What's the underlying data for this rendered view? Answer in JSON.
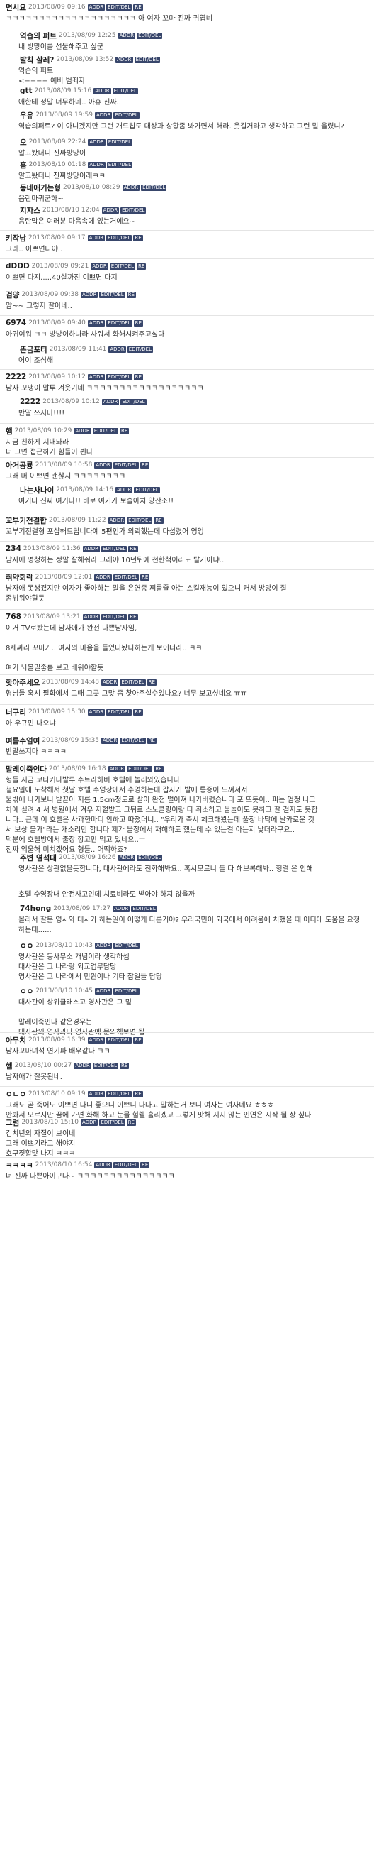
{
  "buttons": {
    "addr": "ADDR",
    "edit": "EDIT/DEL",
    "re": "RE"
  },
  "comments": [
    {
      "level": 0,
      "h": 40,
      "nick": "면시요",
      "date": "2013/08/09 09:16",
      "re": true,
      "body": "ㅋㅋㅋㅋㅋㅋㅋㅋㅋㅋㅋㅋㅋㅋㅋㅋㅋㅋㅋㅋ 아 여자 꼬마 진짜 귀엽네"
    },
    {
      "level": 1,
      "h": 34,
      "nick": "역습의 퍼트",
      "date": "2013/08/09 12:25",
      "re": false,
      "body": "내 방망이를 선물해주고 싶군"
    },
    {
      "level": 1,
      "h": 44,
      "nick": "발칙 샬레?",
      "date": "2013/08/09 13:52",
      "re": false,
      "body": "역습의 퍼트\n<==== 예비 범죄자"
    },
    {
      "level": 1,
      "h": 34,
      "nick": "gtt",
      "date": "2013/08/09 15:16",
      "re": false,
      "body": "애한테 정말 너무하네.. 아휴 진짜.."
    },
    {
      "level": 1,
      "h": 38,
      "nick": "우유",
      "date": "2013/08/09 19:59",
      "re": false,
      "body": "역습의퍼트? 이 아니겠지만 그런 개드립도 대상과 상황좀 봐가면서 해라. 웃길거라고 생각하고 그런 말 올렸니?"
    },
    {
      "level": 1,
      "h": 32,
      "nick": "오",
      "date": "2013/08/09 22:24",
      "re": false,
      "body": "알고봤더니 진짜방망이"
    },
    {
      "level": 1,
      "h": 32,
      "nick": "흠",
      "date": "2013/08/10 01:18",
      "re": false,
      "body": "알고봤더니 진짜방망이래ㅋㅋ"
    },
    {
      "level": 1,
      "h": 32,
      "nick": "동네애기는형",
      "date": "2013/08/10 08:29",
      "re": false,
      "body": "음란마귀군하~"
    },
    {
      "level": 1,
      "h": 38,
      "nick": "지자스",
      "date": "2013/08/10 12:04",
      "re": false,
      "body": "음란맙은 여러분 마음속에 있는거에요~"
    },
    {
      "level": 0,
      "h": 40,
      "nick": "키작남",
      "date": "2013/08/09 09:17",
      "re": true,
      "body": "그래.. 이쁘면다야.."
    },
    {
      "level": 0,
      "h": 40,
      "nick": "dDDD",
      "date": "2013/08/09 09:21",
      "re": true,
      "body": "이쁘면 다지.....40살까진 이쁘면 다지"
    },
    {
      "level": 0,
      "h": 40,
      "nick": "검양",
      "date": "2013/08/09 09:38",
      "re": true,
      "body": "암~~ 그렇지 잘아네.."
    },
    {
      "level": 0,
      "h": 38,
      "nick": "6974",
      "date": "2013/08/09 09:40",
      "re": true,
      "body": "아귀여워 ㅋㅋ 방방이하나라 사줘서 화해시켜주고싶다"
    },
    {
      "level": 1,
      "h": 38,
      "nick": "뜬금포티",
      "date": "2013/08/09 11:41",
      "re": false,
      "body": "어이 조심해"
    },
    {
      "level": 0,
      "h": 36,
      "nick": "2222",
      "date": "2013/08/09 10:12",
      "re": true,
      "body": "남자 꼬맹이 말투 겨웃기네 ㅋㅋㅋㅋㅋㅋㅋㅋㅋㅋㅋㅋㅋㅋㅋㅋㅋㅋ"
    },
    {
      "level": 1,
      "h": 40,
      "nick": "2222",
      "date": "2013/08/09 10:12",
      "re": false,
      "body": "반말 쓰지마!!!!"
    },
    {
      "level": 0,
      "h": 48,
      "nick": "햄",
      "date": "2013/08/09 10:29",
      "re": true,
      "body": "지금 친하게 지내놔라\n더 크면 접근하기 힘들어 뵌다"
    },
    {
      "level": 0,
      "h": 36,
      "nick": "아거공룡",
      "date": "2013/08/09 10:58",
      "re": true,
      "body": "그래 머 이쁘면 괜찮지 ㅋㅋㅋㅋㅋㅋㅋㅋ"
    },
    {
      "level": 1,
      "h": 42,
      "nick": "나는사나이",
      "date": "2013/08/09 14:16",
      "re": false,
      "body": "여기다 진짜 여기다!! 바로 여기가 보슬아치 양산소!!"
    },
    {
      "level": 0,
      "h": 40,
      "nick": "꼬부기전결합",
      "date": "2013/08/09 11:22",
      "re": true,
      "body": "꼬부기전결형 포샵해드립니다예 5편인가 의뢰했는데 다섭렸어 영엉"
    },
    {
      "level": 0,
      "h": 40,
      "nick": "234",
      "date": "2013/08/09 11:36",
      "re": true,
      "body": "남자애 명청하는 정말 잘해줘라 그래야 10년뒤에 천한척이라도 탈거아냐.."
    },
    {
      "level": 0,
      "h": 56,
      "nick": "취약회락",
      "date": "2013/08/09 12:01",
      "re": true,
      "body": "남자애 못생겼지만 여자가 좋아하는 말을 은연중 찌를줄 아는 스킬재능이 있으니 커서 방망이 잘\n좀뷔워야할듯"
    },
    {
      "level": 0,
      "h": 92,
      "nick": "768",
      "date": "2013/08/09 13:21",
      "re": true,
      "body": "이거 TV로봤는데 남자애가 완전 나쁜남자임,\n\n8세짜리 꼬마가.. 여자의 마음을 들었다놨다하는게 보이더라.. ㅋㅋ\n\n여기 놔볼밀좋를 보고 배워야할듯"
    },
    {
      "level": 0,
      "h": 42,
      "nick": "핫아주세요",
      "date": "2013/08/09 14:48",
      "re": true,
      "body": "형님들 혹시 필화에서 그때 그곳 그맛 좀 찾아주실수있나요? 너무 보고싶네요 ㅠㅠ"
    },
    {
      "level": 0,
      "h": 40,
      "nick": "너구리",
      "date": "2013/08/09 15:30",
      "re": true,
      "body": "아 우규민 나오냐"
    },
    {
      "level": 0,
      "h": 40,
      "nick": "여름수염여",
      "date": "2013/08/09 15:35",
      "re": true,
      "body": "반말쓰지마 ㅋㅋㅋㅋ"
    },
    {
      "level": 0,
      "h": 126,
      "nick": "말레이죽인다",
      "date": "2013/08/09 16:18",
      "re": true,
      "body": "헝들 지금 코타키나발루 수트라하버 호텔에 놀러와있습니다\n철요일에 도착해서 첫날 호텔 수영장에서 수영하는데 갑자기 발에 통증이 느껴져서\n물밖에 나가보니 발끝이 지름 1.5cm정도로 살이 완전 떨어져 나가버렸습니다 포 뜨듯이.. 피는 엄청 나고\n차에 실려 4 서 병원에서 겨우 지혈받고 그뒤로 스노클링이랑 다 취소하고 물놀이도 못하고 잘 걷지도 못합\n니다.. 근데 이 호텔은 사과한마디 안하고 따졌더니.. \"우리가 즉시 체크해봤는데 풀장 바닥에 날카로운 것\n서 보상 불가\"라는 개소리만 합니다 제가 물장에서 재해하도 했는데 수 있는걸 아는지 낯더라구요..\n덕분에 호텔방에서 출장 깡고만 먹고 있네요..ㅜ\n진짜 억울해 미치겠어요 형들.. 어떡하죠?"
    },
    {
      "level": 1,
      "h": 36,
      "nick": "주변 염석대",
      "date": "2013/08/09 16:26",
      "re": false,
      "body": "영사관은 상관없을듯합니다, 대사관에라도 전화해봐요.. 혹시모르니 돌 다 해보록해봐.. 헝결 은 안해"
    },
    {
      "level": 1,
      "h": 36,
      "nick": "",
      "date": "",
      "re": false,
      "body": "호텔 수영장내 안전사고인데 치료비라도 받아야 하지 않을까"
    },
    {
      "level": 1,
      "h": 52,
      "nick": "74hong",
      "date": "2013/08/09 17:27",
      "re": false,
      "body": "몰라서 잘문 영사와 대사가 하는일이 어떻게 다른거야? 우리국민이 외국에서 어려움에 처했을 때 어디에 도움을 요청\n하는데......"
    },
    {
      "level": 1,
      "h": 64,
      "nick": "ㅇㅇ",
      "date": "2013/08/10 10:43",
      "re": false,
      "body": "영사관은 동사무소 개념이라 생각하셈\n대사관은 그 나라랑 외교업무담당\n영사관은 그 나라에서 민원이나 기타 잡일들 담당"
    },
    {
      "level": 1,
      "h": 68,
      "nick": "ㅇㅇ",
      "date": "2013/08/10 10:45",
      "re": false,
      "body": "대사관이 상위클래스고 영사관은 그 밑\n\n말레이죽인다 같은경우는\n대사관의 영사과나 영사관에 문의해보면 될"
    },
    {
      "level": 0,
      "h": 36,
      "nick": "아무치",
      "date": "2013/08/09 16:39",
      "re": true,
      "body": "남자꼬마녀석 연기파 배우같다 ㅋㅋ"
    },
    {
      "level": 0,
      "h": 40,
      "nick": "헴",
      "date": "2013/08/10 00:27",
      "re": true,
      "body": "남자애가 잘못된네."
    },
    {
      "level": 0,
      "h": 40,
      "nick": "ㅇㄴㅇ",
      "date": "2013/08/10 09:19",
      "re": true,
      "body": "그래도 곧 죽어도 이쁘면 다니 좋으니 이쁘니 다다고 말하는거 보니 여자는 여자네요 ㅎㅎㅎ\n안봐서 모르지만 꿈에 가면 화해 하고 눈물 헐쉘 흘리겠고 그렇게 맛해 지지 않는 인연은 시작 될 상 싶다"
    },
    {
      "level": 0,
      "h": 60,
      "nick": "그럼",
      "date": "2013/08/10 15:10",
      "re": true,
      "body": "김치년의 자질이 보이네\n그래 이쁘기라고 해야지\n호구짓할맛 나지 ㅋㅋㅋ"
    },
    {
      "level": 0,
      "h": 40,
      "nick": "ㅋㅋㅋㅋ",
      "date": "2013/08/10 16:54",
      "re": true,
      "body": "너 진짜 나쁜아이구나~ ㅋㅋㅋㅋㅋㅋㅋㅋㅋㅋㅋㅋㅋㅋㅋ"
    }
  ]
}
